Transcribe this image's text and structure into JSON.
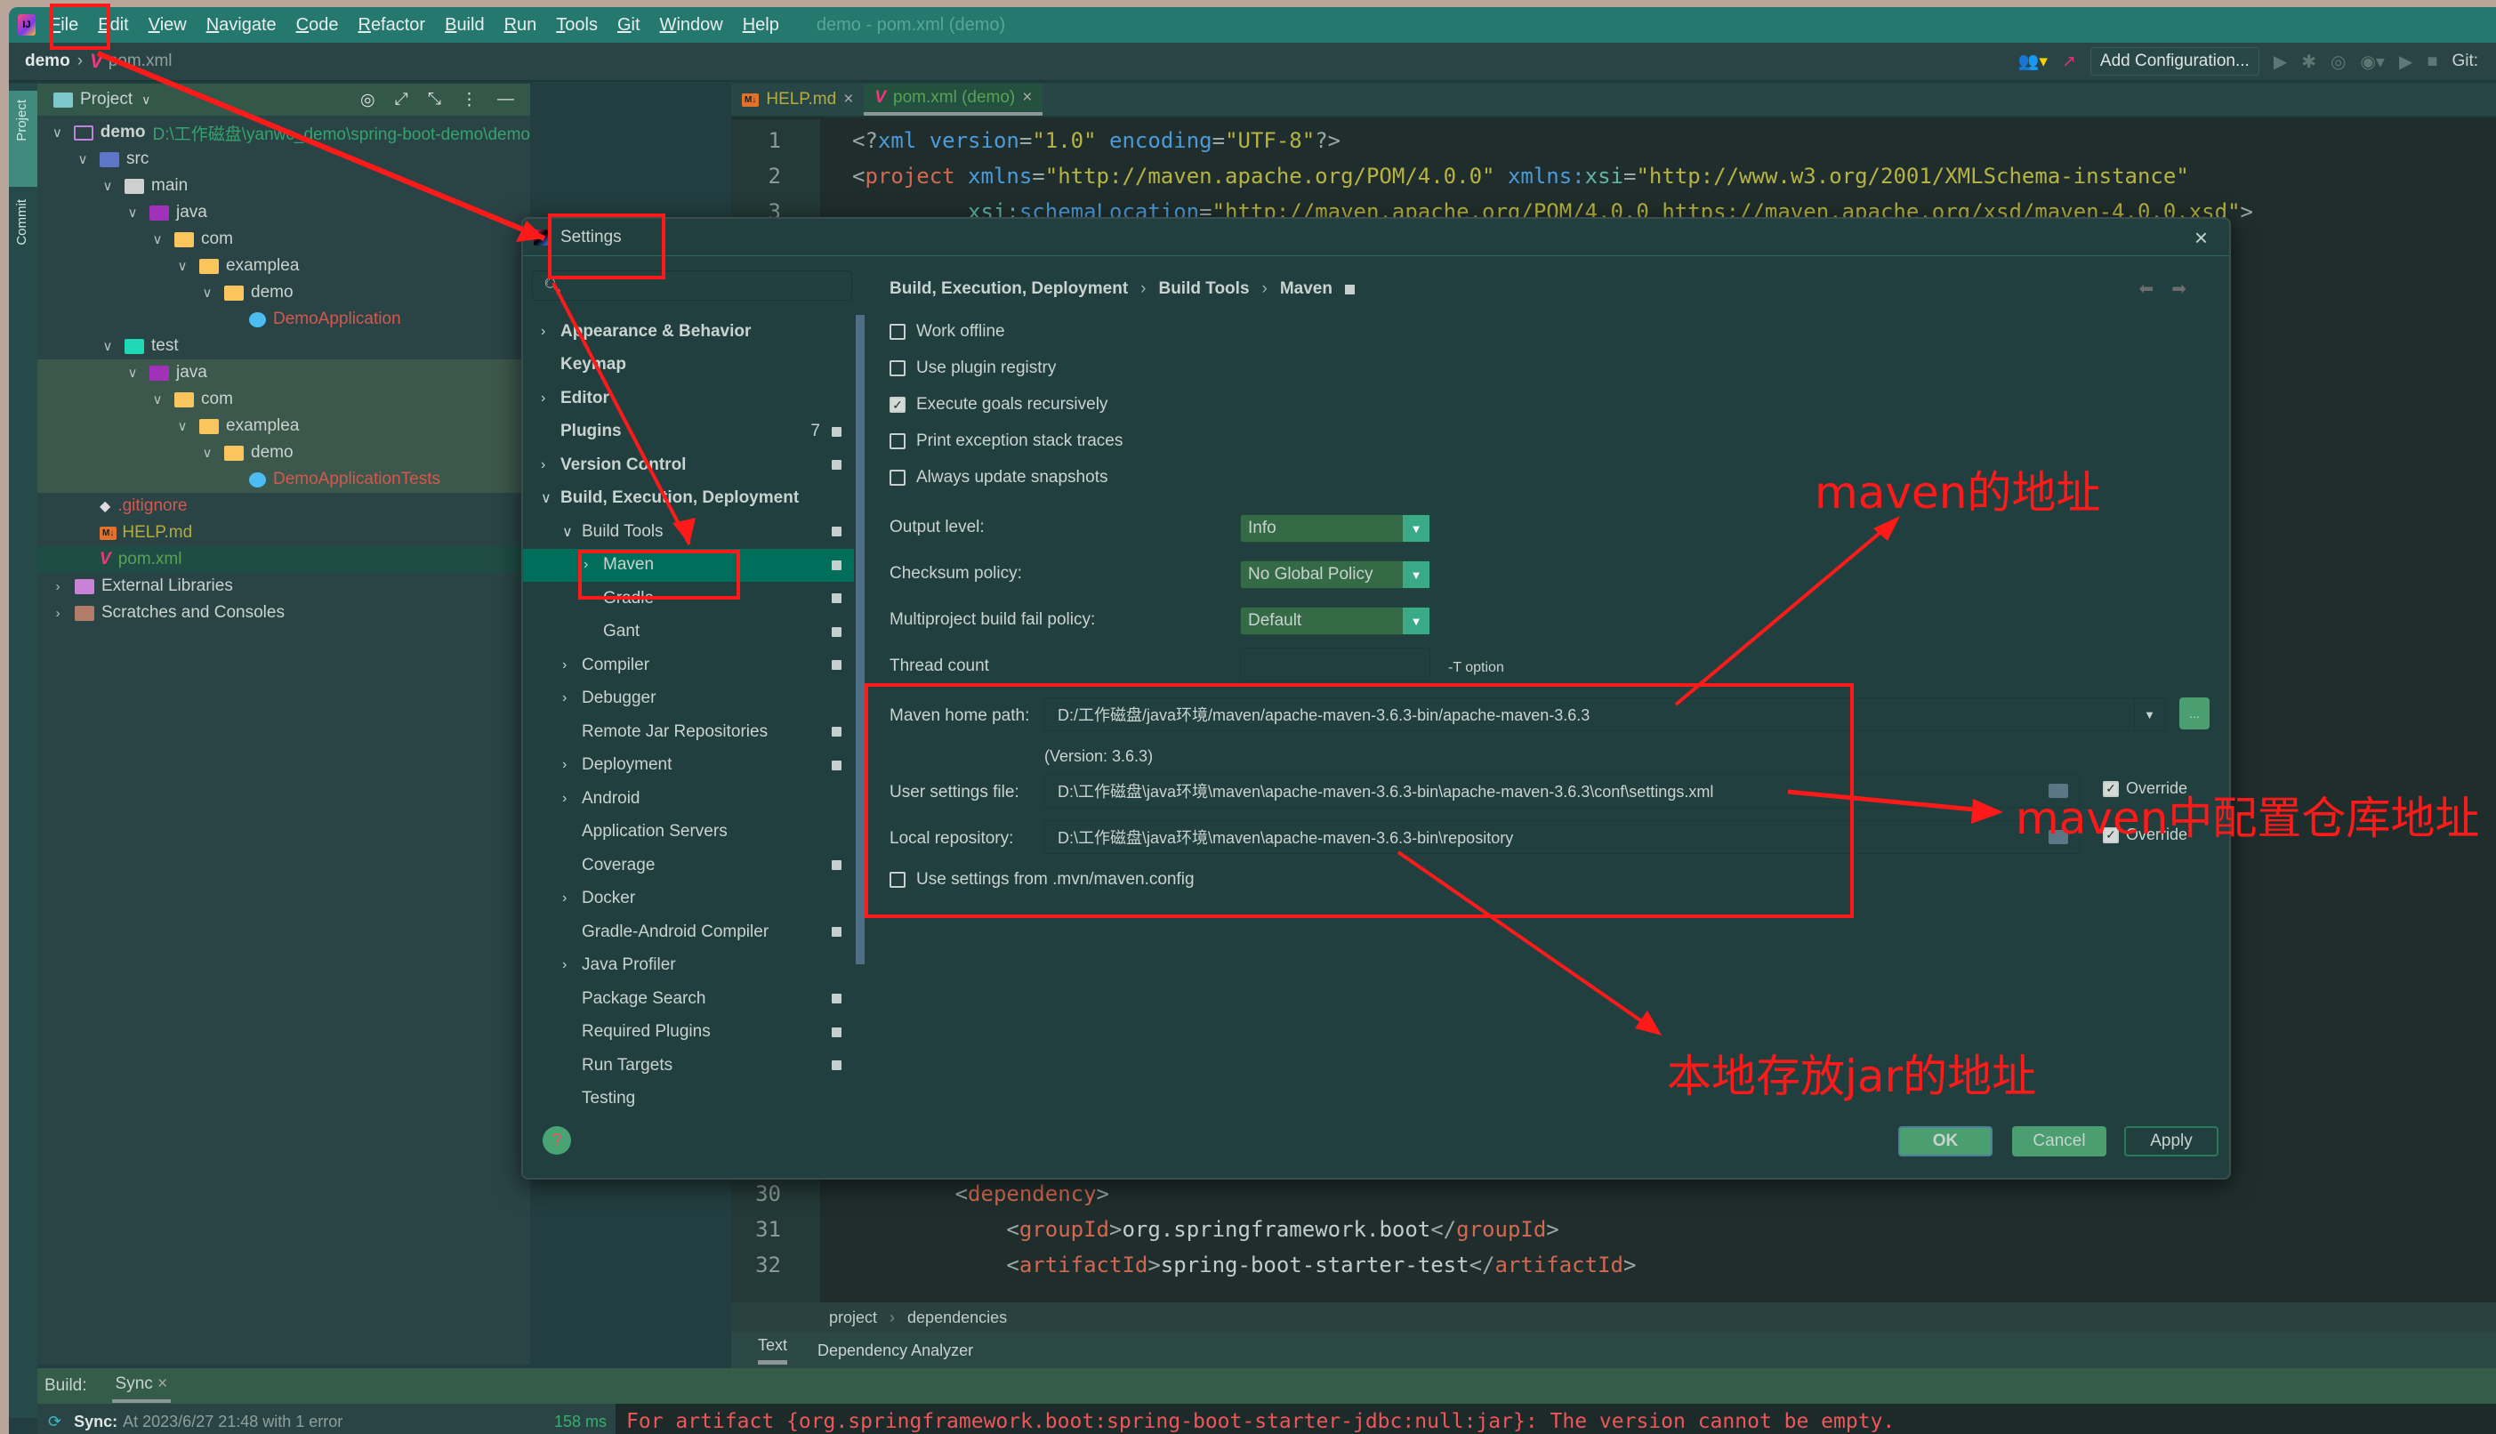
{
  "menubar": {
    "items": [
      "File",
      "Edit",
      "View",
      "Navigate",
      "Code",
      "Refactor",
      "Build",
      "Run",
      "Tools",
      "Git",
      "Window",
      "Help"
    ],
    "window_title": "demo - pom.xml (demo)"
  },
  "navbar": {
    "root": "demo",
    "file": "pom.xml",
    "add_configuration": "Add Configuration...",
    "git_label": "Git:"
  },
  "left_strip": {
    "project": "Project",
    "commit": "Commit"
  },
  "project_panel": {
    "title": "Project",
    "tree": [
      {
        "label": "demo",
        "extra": "D:\\工作磁盘\\yanwc_demo\\spring-boot-demo\\demo",
        "icon": "module-icon",
        "depth": 0,
        "expanded": true
      },
      {
        "label": "src",
        "icon": "source-folder-icon",
        "depth": 1,
        "expanded": true
      },
      {
        "label": "main",
        "icon": "folder-icon",
        "depth": 2,
        "expanded": true
      },
      {
        "label": "java",
        "icon": "java-folder-icon",
        "depth": 3,
        "expanded": true
      },
      {
        "label": "com",
        "icon": "package-icon",
        "depth": 4,
        "expanded": true
      },
      {
        "label": "examplea",
        "icon": "package-icon",
        "depth": 5,
        "expanded": true
      },
      {
        "label": "demo",
        "icon": "package-icon",
        "depth": 6,
        "expanded": true
      },
      {
        "label": "DemoApplication",
        "icon": "spring-class-icon",
        "depth": 7,
        "color": "red"
      },
      {
        "label": "test",
        "icon": "test-folder-icon",
        "depth": 2,
        "expanded": true
      },
      {
        "label": "java",
        "icon": "java-folder-icon",
        "depth": 3,
        "expanded": true,
        "hl": "test"
      },
      {
        "label": "com",
        "icon": "package-icon",
        "depth": 4,
        "expanded": true,
        "hl": "test"
      },
      {
        "label": "examplea",
        "icon": "package-icon",
        "depth": 5,
        "expanded": true,
        "hl": "test"
      },
      {
        "label": "demo",
        "icon": "package-icon",
        "depth": 6,
        "expanded": true,
        "hl": "test"
      },
      {
        "label": "DemoApplicationTests",
        "icon": "test-class-icon",
        "depth": 7,
        "color": "red",
        "hl": "test"
      },
      {
        "label": ".gitignore",
        "icon": "git-icon",
        "depth": 1,
        "color": "red"
      },
      {
        "label": "HELP.md",
        "icon": "markdown-icon",
        "depth": 1,
        "color": "yellow"
      },
      {
        "label": "pom.xml",
        "icon": "maven-icon",
        "depth": 1,
        "color": "green",
        "hl": "pom"
      },
      {
        "label": "External Libraries",
        "icon": "library-icon",
        "depth": 0,
        "expanded": false
      },
      {
        "label": "Scratches and Consoles",
        "icon": "scratch-icon",
        "depth": 0,
        "expanded": false
      }
    ]
  },
  "editor": {
    "tabs": [
      {
        "label": "HELP.md",
        "icon": "markdown-icon",
        "active": false
      },
      {
        "label": "pom.xml (demo)",
        "icon": "maven-icon",
        "active": true
      }
    ],
    "top_lines": [
      {
        "n": "1",
        "parts": [
          [
            "br",
            "<?"
          ],
          [
            "attr",
            "xml version"
          ],
          [
            "br",
            "="
          ],
          [
            "str",
            "\"1.0\""
          ],
          [
            "br",
            " "
          ],
          [
            "attr",
            "encoding"
          ],
          [
            "br",
            "="
          ],
          [
            "str",
            "\"UTF-8\""
          ],
          [
            "br",
            "?>"
          ]
        ]
      },
      {
        "n": "2",
        "parts": [
          [
            "br",
            "<"
          ],
          [
            "tag",
            "project "
          ],
          [
            "attr",
            "xmlns"
          ],
          [
            "br",
            "="
          ],
          [
            "str",
            "\"http://maven.apache.org/POM/4.0.0\""
          ],
          [
            "br",
            " "
          ],
          [
            "attr",
            "xmlns:"
          ],
          [
            "ns",
            "xsi"
          ],
          [
            "br",
            "="
          ],
          [
            "str",
            "\"http://www.w3.org/2001/XMLSchema-instance\""
          ]
        ]
      },
      {
        "n": "3",
        "parts": [
          [
            "br",
            "         "
          ],
          [
            "ns",
            "xsi:"
          ],
          [
            "attr",
            "schemaLocation"
          ],
          [
            "br",
            "="
          ],
          [
            "str",
            "\"http://maven.apache.org/POM/4.0.0 https://maven.apache.org/xsd/maven-4.0.0.xsd\""
          ],
          [
            "br",
            ">"
          ]
        ]
      }
    ],
    "bottom_lines": [
      {
        "n": "30",
        "parts": [
          [
            "br",
            "        <"
          ],
          [
            "tag",
            "dependency"
          ],
          [
            "br",
            ">"
          ]
        ]
      },
      {
        "n": "31",
        "parts": [
          [
            "br",
            "            <"
          ],
          [
            "tag",
            "groupId"
          ],
          [
            "br",
            ">"
          ],
          [
            "txt",
            "org.springframework.boot"
          ],
          [
            "br",
            "</"
          ],
          [
            "tag",
            "groupId"
          ],
          [
            "br",
            ">"
          ]
        ]
      },
      {
        "n": "32",
        "parts": [
          [
            "br",
            "            <"
          ],
          [
            "tag",
            "artifactId"
          ],
          [
            "br",
            ">"
          ],
          [
            "txt",
            "spring-boot-starter-test"
          ],
          [
            "br",
            "</"
          ],
          [
            "tag",
            "artifactId"
          ],
          [
            "br",
            ">"
          ]
        ]
      }
    ],
    "breadcrumbs": [
      "project",
      "dependencies"
    ],
    "bottom_tabs": [
      "Text",
      "Dependency Analyzer"
    ]
  },
  "build_panel": {
    "label": "Build:",
    "tab": "Sync",
    "sync_bold": "Sync:",
    "sync_text": "At 2023/6/27 21:48 with 1 error",
    "duration": "158 ms",
    "error_message": "For artifact {org.springframework.boot:spring-boot-starter-jdbc:null:jar}: The version cannot be empty."
  },
  "settings": {
    "title": "Settings",
    "search_placeholder": "",
    "tree": [
      {
        "label": "Appearance & Behavior",
        "bold": true,
        "chev": ">",
        "level": 0
      },
      {
        "label": "Keymap",
        "bold": true,
        "level": 0
      },
      {
        "label": "Editor",
        "bold": true,
        "chev": ">",
        "level": 0
      },
      {
        "label": "Plugins",
        "bold": true,
        "level": 0,
        "count": "7",
        "proj": true
      },
      {
        "label": "Version Control",
        "bold": true,
        "chev": ">",
        "level": 0,
        "proj": true
      },
      {
        "label": "Build, Execution, Deployment",
        "bold": true,
        "chev": "v",
        "level": 0
      },
      {
        "label": "Build Tools",
        "chev": "v",
        "level": 1,
        "proj": true
      },
      {
        "label": "Maven",
        "chev": ">",
        "level": 2,
        "proj": true,
        "selected": true
      },
      {
        "label": "Gradle",
        "level": 2,
        "proj": true
      },
      {
        "label": "Gant",
        "level": 2,
        "proj": true
      },
      {
        "label": "Compiler",
        "chev": ">",
        "level": 1,
        "proj": true
      },
      {
        "label": "Debugger",
        "chev": ">",
        "level": 1
      },
      {
        "label": "Remote Jar Repositories",
        "level": 1,
        "proj": true
      },
      {
        "label": "Deployment",
        "chev": ">",
        "level": 1,
        "proj": true
      },
      {
        "label": "Android",
        "chev": ">",
        "level": 1
      },
      {
        "label": "Application Servers",
        "level": 1
      },
      {
        "label": "Coverage",
        "level": 1,
        "proj": true
      },
      {
        "label": "Docker",
        "chev": ">",
        "level": 1
      },
      {
        "label": "Gradle-Android Compiler",
        "level": 1,
        "proj": true
      },
      {
        "label": "Java Profiler",
        "chev": ">",
        "level": 1
      },
      {
        "label": "Package Search",
        "level": 1,
        "proj": true
      },
      {
        "label": "Required Plugins",
        "level": 1,
        "proj": true
      },
      {
        "label": "Run Targets",
        "level": 1,
        "proj": true
      },
      {
        "label": "Testing",
        "level": 1
      }
    ],
    "breadcrumb": [
      "Build, Execution, Deployment",
      "Build Tools",
      "Maven"
    ],
    "checkboxes": [
      {
        "label": "Work offline",
        "checked": false
      },
      {
        "label": "Use plugin registry",
        "checked": false
      },
      {
        "label": "Execute goals recursively",
        "checked": true
      },
      {
        "label": "Print exception stack traces",
        "checked": false
      },
      {
        "label": "Always update snapshots",
        "checked": false
      }
    ],
    "output_level": {
      "label": "Output level:",
      "value": "Info"
    },
    "checksum_policy": {
      "label": "Checksum policy:",
      "value": "No Global Policy"
    },
    "fail_policy": {
      "label": "Multiproject build fail policy:",
      "value": "Default"
    },
    "thread_count": {
      "label": "Thread count",
      "value": "",
      "suffix": "-T option"
    },
    "maven_home": {
      "label": "Maven home path:",
      "value": "D:/工作磁盘/java环境/maven/apache-maven-3.6.3-bin/apache-maven-3.6.3",
      "browse": "..."
    },
    "version": "(Version: 3.6.3)",
    "user_settings": {
      "label": "User settings file:",
      "value": "D:\\工作磁盘\\java环境\\maven\\apache-maven-3.6.3-bin\\apache-maven-3.6.3\\conf\\settings.xml",
      "override_label": "Override",
      "override": true
    },
    "local_repo": {
      "label": "Local repository:",
      "value": "D:\\工作磁盘\\java环境\\maven\\apache-maven-3.6.3-bin\\repository",
      "override_label": "Override",
      "override": true
    },
    "use_mvn_config": {
      "label": "Use settings from .mvn/maven.config",
      "checked": false
    },
    "buttons": {
      "ok": "OK",
      "cancel": "Cancel",
      "apply": "Apply"
    }
  },
  "annotations": {
    "maven_home_note": "maven的地址",
    "settings_note": "maven中配置仓库地址",
    "repo_note": "本地存放jar的地址",
    "color": "#ff1a1a"
  }
}
